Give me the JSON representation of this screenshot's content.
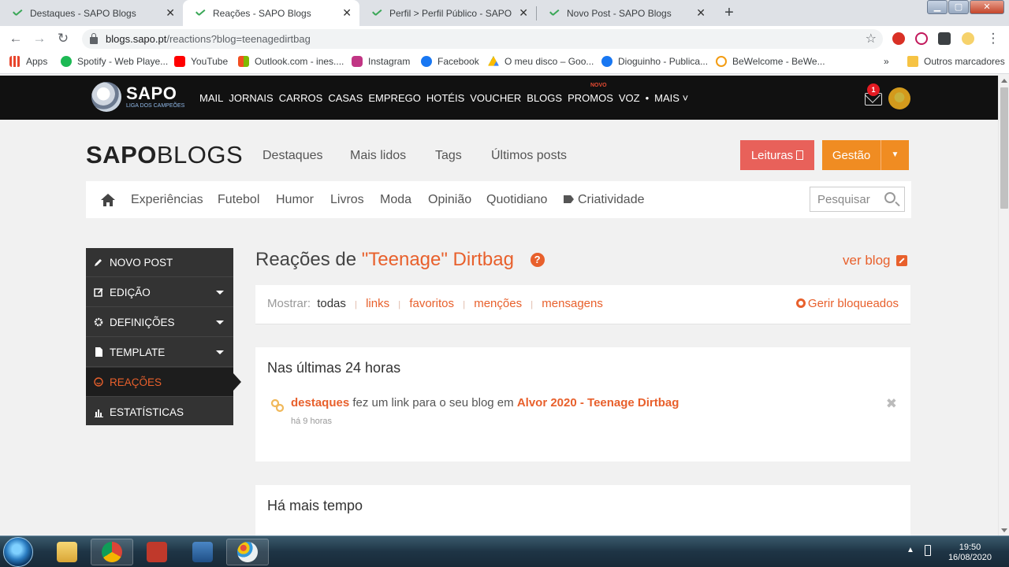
{
  "browser": {
    "tabs": [
      {
        "label": "Destaques - SAPO Blogs",
        "close": "✕",
        "active": false
      },
      {
        "label": "Reações - SAPO Blogs",
        "close": "✕",
        "active": true
      },
      {
        "label": "Perfil > Perfil Público - SAPO Blo",
        "close": "✕",
        "active": false
      },
      {
        "label": "Novo Post - SAPO Blogs",
        "close": "✕",
        "active": false
      }
    ],
    "new_tab": "+",
    "url_host": "blogs.sapo.pt",
    "url_path": "/reactions?blog=teenagedirtbag",
    "bookmarks": [
      {
        "label": "Apps",
        "color": "#e8452c"
      },
      {
        "label": "Spotify - Web Playe...",
        "color": "#1db954"
      },
      {
        "label": "YouTube",
        "color": "#ff0000"
      },
      {
        "label": "Outlook.com - ines....",
        "color": "#f3a321"
      },
      {
        "label": "Instagram",
        "color": "#c13584"
      },
      {
        "label": "Facebook",
        "color": "#1877f2"
      },
      {
        "label": "O meu disco – Goo...",
        "color": "#fbbc04"
      },
      {
        "label": "Dioguinho - Publica...",
        "color": "#1877f2"
      },
      {
        "label": "BeWelcome - BeWe...",
        "color": "#f39c12"
      }
    ],
    "bookmarks_more": "»",
    "other_bookmarks": "Outros marcadores"
  },
  "sapo_bar": {
    "logo": "SAPO",
    "logo_sub": "LIGA DOS CAMPEÕES",
    "menu": [
      "MAIL",
      "JORNAIS",
      "CARROS",
      "CASAS",
      "EMPREGO",
      "HOTÉIS",
      "VOUCHER",
      "BLOGS",
      "PROMOS",
      "VOZ",
      "•",
      "MAIS ˅"
    ],
    "novo_badge": "NOVO",
    "mail_count": "1"
  },
  "blogs_header": {
    "brand_bold": "SAPO",
    "brand_light": "BLOGS",
    "nav": [
      "Destaques",
      "Mais lidos",
      "Tags",
      "Últimos posts"
    ],
    "leituras": "Leituras",
    "gestao": "Gestão",
    "gestao_caret": "▼"
  },
  "categories": {
    "items": [
      "Experiências",
      "Futebol",
      "Humor",
      "Livros",
      "Moda",
      "Opinião",
      "Quotidiano",
      "Criatividade"
    ],
    "search_placeholder": "Pesquisar"
  },
  "sidebar": {
    "items": [
      {
        "label": "NOVO POST"
      },
      {
        "label": "EDIÇÃO"
      },
      {
        "label": "DEFINIÇÕES"
      },
      {
        "label": "TEMPLATE"
      },
      {
        "label": "REAÇÕES"
      },
      {
        "label": "ESTATÍSTICAS"
      }
    ]
  },
  "main": {
    "title_prefix": "Reações de ",
    "title_blog": "\"Teenage\" Dirtbag",
    "help": "?",
    "ver_blog": "ver blog",
    "filter_label": "Mostrar:",
    "filters": [
      "todas",
      "links",
      "favoritos",
      "menções",
      "mensagens"
    ],
    "filter_sep": "|",
    "gerir": "Gerir bloqueados",
    "section1_title": "Nas últimas 24 horas",
    "reaction_user": "destaques",
    "reaction_text": " fez um link para o seu blog em ",
    "reaction_post": "Alvor 2020 - Teenage Dirtbag",
    "reaction_time": "há 9 horas",
    "reaction_close": "✖",
    "section2_title": "Há mais tempo"
  },
  "system": {
    "time": "19:50",
    "date": "16/08/2020"
  }
}
